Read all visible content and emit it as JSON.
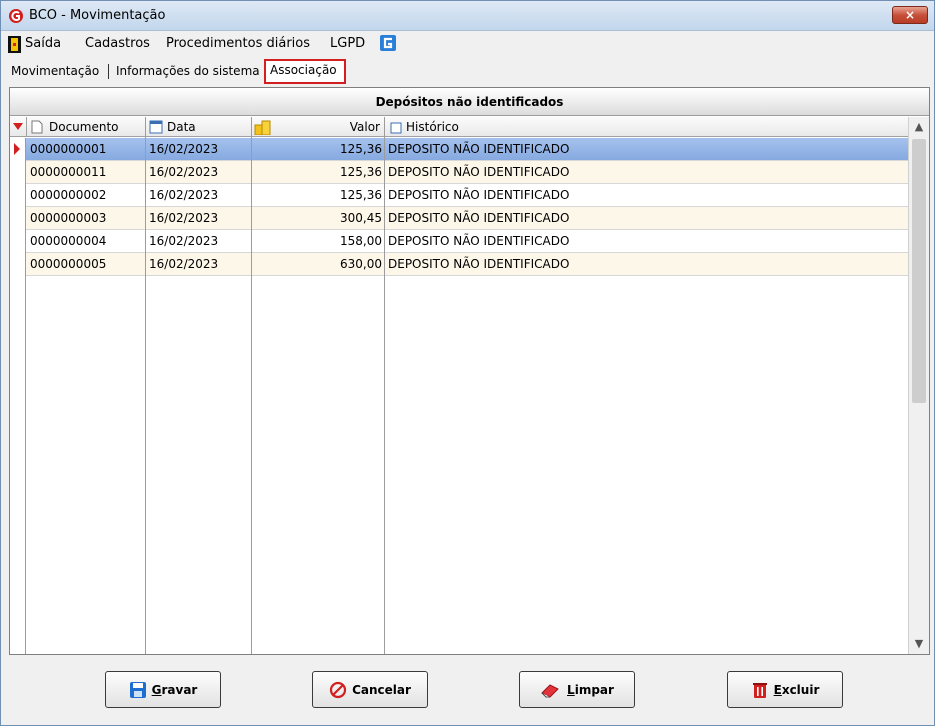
{
  "window": {
    "title": "BCO - Movimentação",
    "close_glyph": "×"
  },
  "menu": {
    "items": [
      "Saída",
      "Cadastros",
      "Procedimentos diários",
      "LGPD"
    ],
    "icons": [
      "exit-icon",
      "g-logo-icon"
    ]
  },
  "tabs": {
    "items": [
      "Movimentação",
      "Informações do sistema"
    ],
    "active": "Associação"
  },
  "panel": {
    "title": "Depósitos não identificados",
    "columns": [
      "Documento",
      "Data",
      "Valor",
      "Histórico"
    ],
    "rows": [
      {
        "documento": "0000000001",
        "data": "16/02/2023",
        "valor": "125,36",
        "historico": "DEPOSITO NÃO IDENTIFICADO"
      },
      {
        "documento": "0000000011",
        "data": "16/02/2023",
        "valor": "125,36",
        "historico": "DEPOSITO NÃO IDENTIFICADO"
      },
      {
        "documento": "0000000002",
        "data": "16/02/2023",
        "valor": "125,36",
        "historico": "DEPOSITO NÃO IDENTIFICADO"
      },
      {
        "documento": "0000000003",
        "data": "16/02/2023",
        "valor": "300,45",
        "historico": "DEPOSITO NÃO IDENTIFICADO"
      },
      {
        "documento": "0000000004",
        "data": "16/02/2023",
        "valor": "158,00",
        "historico": "DEPOSITO NÃO IDENTIFICADO"
      },
      {
        "documento": "0000000005",
        "data": "16/02/2023",
        "valor": "630,00",
        "historico": "DEPOSITO NÃO IDENTIFICADO"
      }
    ],
    "selected_row": 0
  },
  "buttons": {
    "gravar": {
      "first": "G",
      "rest": "ravar",
      "icon": "save-icon"
    },
    "cancelar": {
      "first": "",
      "rest": "Cancelar",
      "icon": "cancel-icon"
    },
    "limpar": {
      "first": "L",
      "rest": "impar",
      "icon": "eraser-icon"
    },
    "excluir": {
      "first": "E",
      "rest": "xcluir",
      "icon": "trash-icon"
    }
  },
  "colors": {
    "accent_red": "#d21f1f",
    "selection": "#93b3e6",
    "row_alt": "#fdf7ea"
  }
}
